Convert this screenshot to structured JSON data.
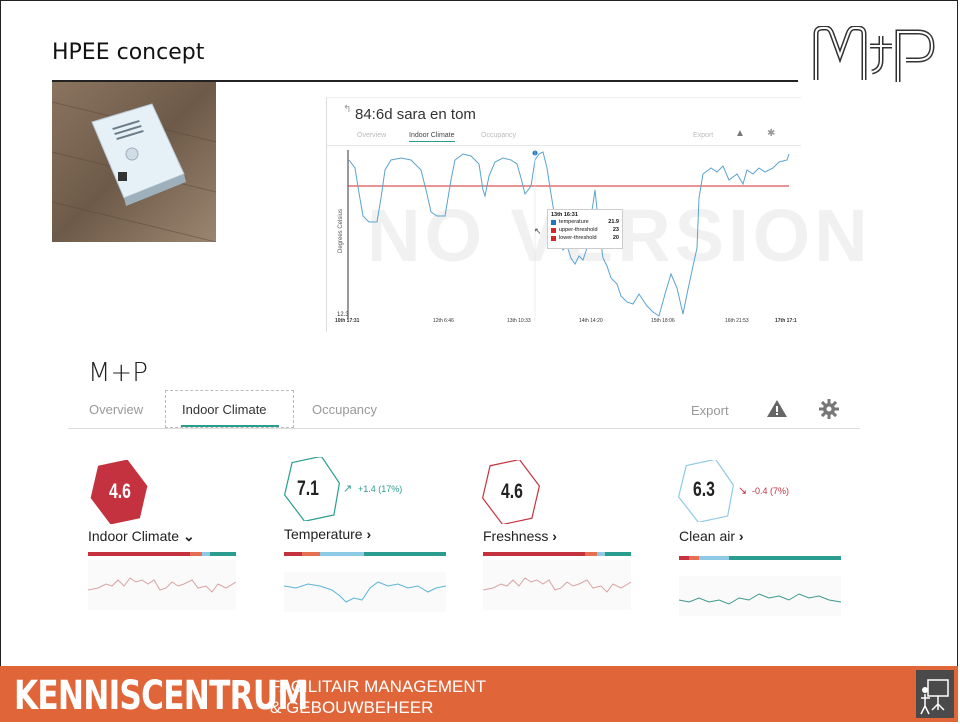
{
  "slide": {
    "title": "HPEE concept"
  },
  "screenshot": {
    "device_title": "84:6d sara en tom",
    "tabs": [
      "Overview",
      "Indoor Climate",
      "Occupancy"
    ],
    "active_tab": "Indoor Climate",
    "export_label": "Export",
    "y_axis_label": "Degrees Celsius",
    "y_min_label": "12.3",
    "x_ticks": [
      "10th 17:31",
      "12th 6:46",
      "13th 10:33",
      "14th 14:20",
      "15th 18:06",
      "16th 21:53",
      "17th 17:1"
    ],
    "watermark": "NO VERSION",
    "tooltip": {
      "title": "13th 16:31",
      "rows": [
        {
          "name": "temperature",
          "value": "21.9",
          "color": "#1f77c4"
        },
        {
          "name": "upper-threshold",
          "value": "23",
          "color": "#d62728"
        },
        {
          "name": "lower-threshold",
          "value": "20",
          "color": "#d62728"
        }
      ]
    }
  },
  "dashboard": {
    "brand": "M+P",
    "tabs": {
      "overview": "Overview",
      "indoor": "Indoor Climate",
      "occupancy": "Occupancy"
    },
    "export_label": "Export",
    "tiles": [
      {
        "value": "4.6",
        "label": "Indoor Climate",
        "chevron": "⌄",
        "delta": "",
        "hex_color": "#c4323f",
        "filled": true
      },
      {
        "value": "7.1",
        "label": "Temperature",
        "chevron": "›",
        "delta": "+1.4 (17%)",
        "hex_color": "#2a9d8f",
        "filled": false
      },
      {
        "value": "4.6",
        "label": "Freshness",
        "chevron": "›",
        "delta": "",
        "hex_color": "#c4323f",
        "filled": false
      },
      {
        "value": "6.3",
        "label": "Clean air",
        "chevron": "›",
        "delta": "-0.4 (7%)",
        "hex_color": "#8ecae6",
        "filled": false
      }
    ]
  },
  "footer": {
    "main": "KENNISCENTRUM",
    "line1": "FACILITAIR MANAGEMENT",
    "line2": "& GEBOUWBEHEER"
  }
}
